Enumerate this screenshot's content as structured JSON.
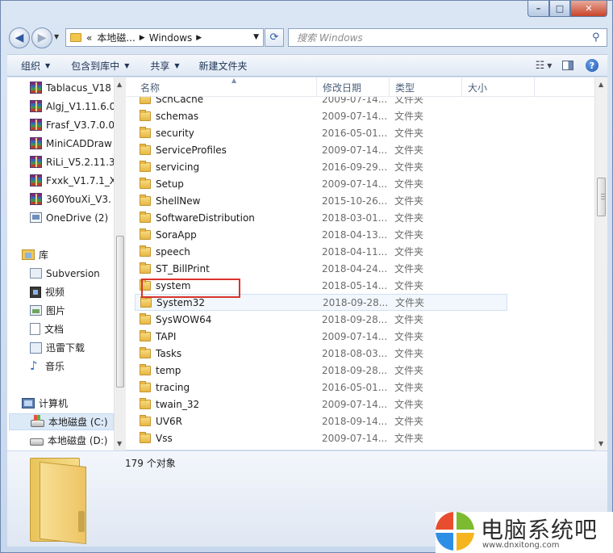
{
  "window": {
    "caption_buttons": {
      "minimize": "–",
      "maximize": "□",
      "close": "✕"
    }
  },
  "navbar": {
    "address_parts": [
      "«",
      "本地磁...",
      "Windows"
    ],
    "search_placeholder": "搜索 Windows"
  },
  "toolbar": {
    "organize": "组织",
    "include_library": "包含到库中",
    "share": "共享",
    "new_folder": "新建文件夹"
  },
  "nav_pane": {
    "items": [
      {
        "label": "Tablacus_V18",
        "icon": "winrar-icon"
      },
      {
        "label": "Algj_V1.11.6.0",
        "icon": "winrar-icon"
      },
      {
        "label": "Frasf_V3.7.0.0",
        "icon": "winrar-icon"
      },
      {
        "label": "MiniCADDraw",
        "icon": "winrar-icon"
      },
      {
        "label": "RiLi_V5.2.11.3",
        "icon": "winrar-icon"
      },
      {
        "label": "Fxxk_V1.7.1_X",
        "icon": "winrar-icon"
      },
      {
        "label": "360YouXi_V3.",
        "icon": "winrar-icon"
      },
      {
        "label": "OneDrive (2)",
        "icon": "onedrive-icon"
      }
    ],
    "libraries": {
      "label": "库",
      "items": [
        "Subversion",
        "视频",
        "图片",
        "文档",
        "迅雷下载",
        "音乐"
      ]
    },
    "computer": {
      "label": "计算机",
      "drives": [
        "本地磁盘 (C:)",
        "本地磁盘 (D:)"
      ]
    }
  },
  "file_list": {
    "columns": [
      "名称",
      "修改日期",
      "类型",
      "大小"
    ],
    "rows": [
      {
        "name": "SchCache",
        "date": "2009-07-14...",
        "type": "文件夹"
      },
      {
        "name": "schemas",
        "date": "2009-07-14...",
        "type": "文件夹"
      },
      {
        "name": "security",
        "date": "2016-05-01...",
        "type": "文件夹"
      },
      {
        "name": "ServiceProfiles",
        "date": "2009-07-14...",
        "type": "文件夹"
      },
      {
        "name": "servicing",
        "date": "2016-09-29...",
        "type": "文件夹"
      },
      {
        "name": "Setup",
        "date": "2009-07-14...",
        "type": "文件夹"
      },
      {
        "name": "ShellNew",
        "date": "2015-10-26...",
        "type": "文件夹"
      },
      {
        "name": "SoftwareDistribution",
        "date": "2018-03-01...",
        "type": "文件夹"
      },
      {
        "name": "SoraApp",
        "date": "2018-04-13...",
        "type": "文件夹"
      },
      {
        "name": "speech",
        "date": "2018-04-11...",
        "type": "文件夹"
      },
      {
        "name": "ST_BillPrint",
        "date": "2018-04-24...",
        "type": "文件夹"
      },
      {
        "name": "system",
        "date": "2018-05-14...",
        "type": "文件夹"
      },
      {
        "name": "System32",
        "date": "2018-09-28...",
        "type": "文件夹"
      },
      {
        "name": "SysWOW64",
        "date": "2018-09-28...",
        "type": "文件夹"
      },
      {
        "name": "TAPI",
        "date": "2009-07-14...",
        "type": "文件夹"
      },
      {
        "name": "Tasks",
        "date": "2018-08-03...",
        "type": "文件夹"
      },
      {
        "name": "temp",
        "date": "2018-09-28...",
        "type": "文件夹"
      },
      {
        "name": "tracing",
        "date": "2016-05-01...",
        "type": "文件夹"
      },
      {
        "name": "twain_32",
        "date": "2009-07-14...",
        "type": "文件夹"
      },
      {
        "name": "UV6R",
        "date": "2018-09-14...",
        "type": "文件夹"
      },
      {
        "name": "Vss",
        "date": "2009-07-14...",
        "type": "文件夹"
      }
    ]
  },
  "details": {
    "count": "179 个对象"
  },
  "watermark": {
    "title": "电脑系统吧",
    "url": "www.dnxitong.com"
  },
  "colors": {
    "highlight_box": "#d9342c",
    "selection": "#dceaf8",
    "folder": "#e8b743"
  }
}
